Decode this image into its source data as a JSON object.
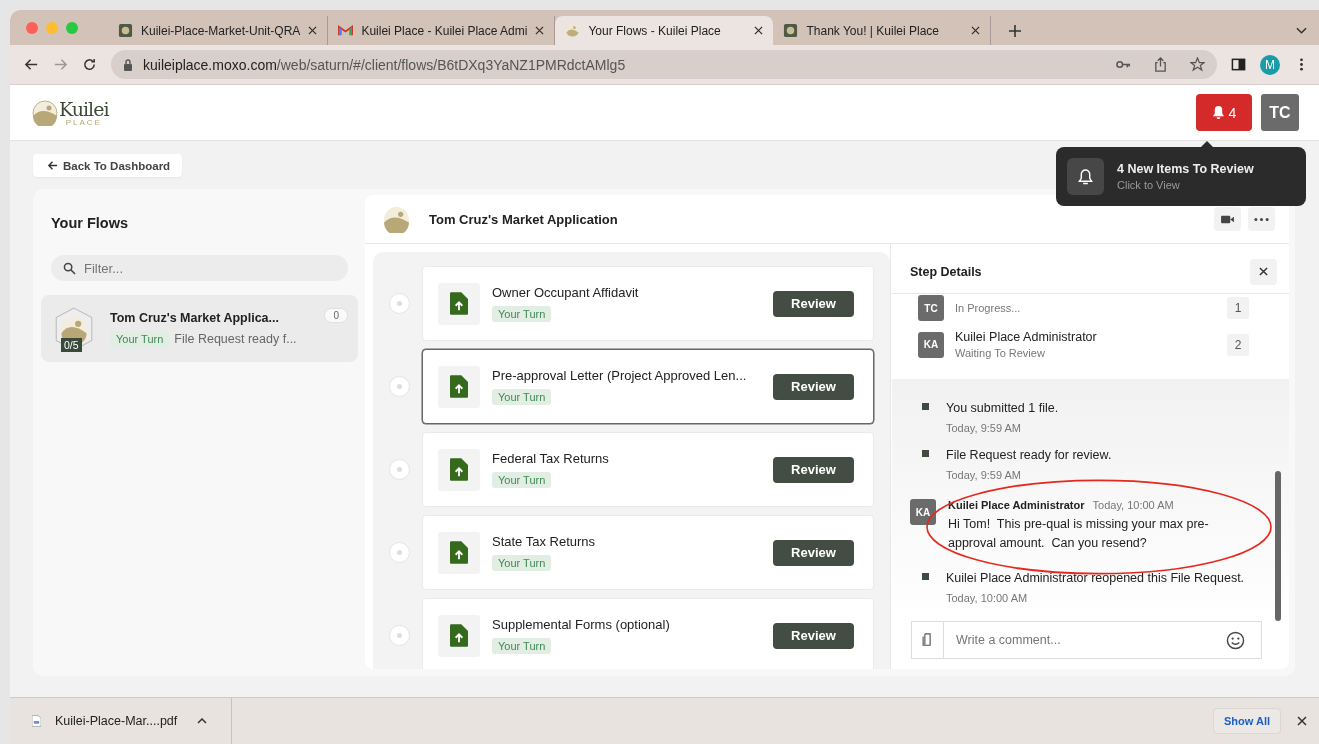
{
  "browser": {
    "tabs": [
      {
        "title": "Kuilei-Place-Market-Unit-QRA",
        "kind": "site",
        "selected": false
      },
      {
        "title": "Kuilei Place - Kuilei Place Admi",
        "kind": "mail",
        "selected": false
      },
      {
        "title": "Your Flows - Kuilei Place",
        "kind": "app",
        "selected": true
      },
      {
        "title": "Thank You! | Kuilei Place",
        "kind": "site",
        "selected": false
      }
    ],
    "url": {
      "host": "kuileiplace.moxo.com",
      "path": "/web/saturn/#/client/flows/B6tDXq3YaNZ1PMRdctAMlg5"
    },
    "profile_initial": "M"
  },
  "header": {
    "logo_text": "Kuilei",
    "logo_subtext": "PLACE",
    "notification_count": "4",
    "user_initials": "TC"
  },
  "notification_popup": {
    "title": "4 New Items To Review",
    "subtitle": "Click to View"
  },
  "back_button": "Back To Dashboard",
  "sidebar": {
    "title": "Your Flows",
    "filter_placeholder": "Filter...",
    "flows": [
      {
        "name": "Tom Cruz's Market Applica...",
        "progress": "0/5",
        "status": "Your Turn",
        "preview": "File Request ready f...",
        "count": "0",
        "selected": true
      }
    ]
  },
  "flow": {
    "title": "Tom Cruz's Market Application",
    "steps": [
      {
        "title": "Owner Occupant Affidavit",
        "status": "Your Turn",
        "action": "Review",
        "selected": false
      },
      {
        "title": "Pre-approval Letter (Project Approved Len...",
        "status": "Your Turn",
        "action": "Review",
        "selected": true
      },
      {
        "title": "Federal Tax Returns",
        "status": "Your Turn",
        "action": "Review",
        "selected": false
      },
      {
        "title": "State Tax Returns",
        "status": "Your Turn",
        "action": "Review",
        "selected": false
      },
      {
        "title": "Supplemental Forms (optional)",
        "status": "Your Turn",
        "action": "Review",
        "selected": false
      }
    ]
  },
  "step_details": {
    "title": "Step Details",
    "participants": [
      {
        "initials": "TC",
        "status": "In Progress...",
        "order": "1"
      },
      {
        "initials": "KA",
        "name": "Kuilei Place Administrator",
        "status": "Waiting To Review",
        "order": "2"
      }
    ],
    "activity": [
      {
        "kind": "event",
        "text": "You submitted 1 file.",
        "time": "Today, 9:59 AM"
      },
      {
        "kind": "event",
        "text": "File Request ready for review.",
        "time": "Today, 9:59 AM"
      },
      {
        "kind": "comment",
        "initials": "KA",
        "author": "Kuilei Place Administrator",
        "time": "Today, 10:00 AM",
        "text": "Hi Tom!  This pre-qual is missing your max pre-approval amount.  Can you resend?",
        "highlighted": true
      },
      {
        "kind": "event",
        "text": "Kuilei Place Administrator reopened this File Request.",
        "time": "Today, 10:00 AM"
      }
    ],
    "comment_placeholder": "Write a comment..."
  },
  "downloads": {
    "items": [
      {
        "name": "Kuilei-Place-Mar....pdf"
      }
    ],
    "show_all": "Show All"
  }
}
